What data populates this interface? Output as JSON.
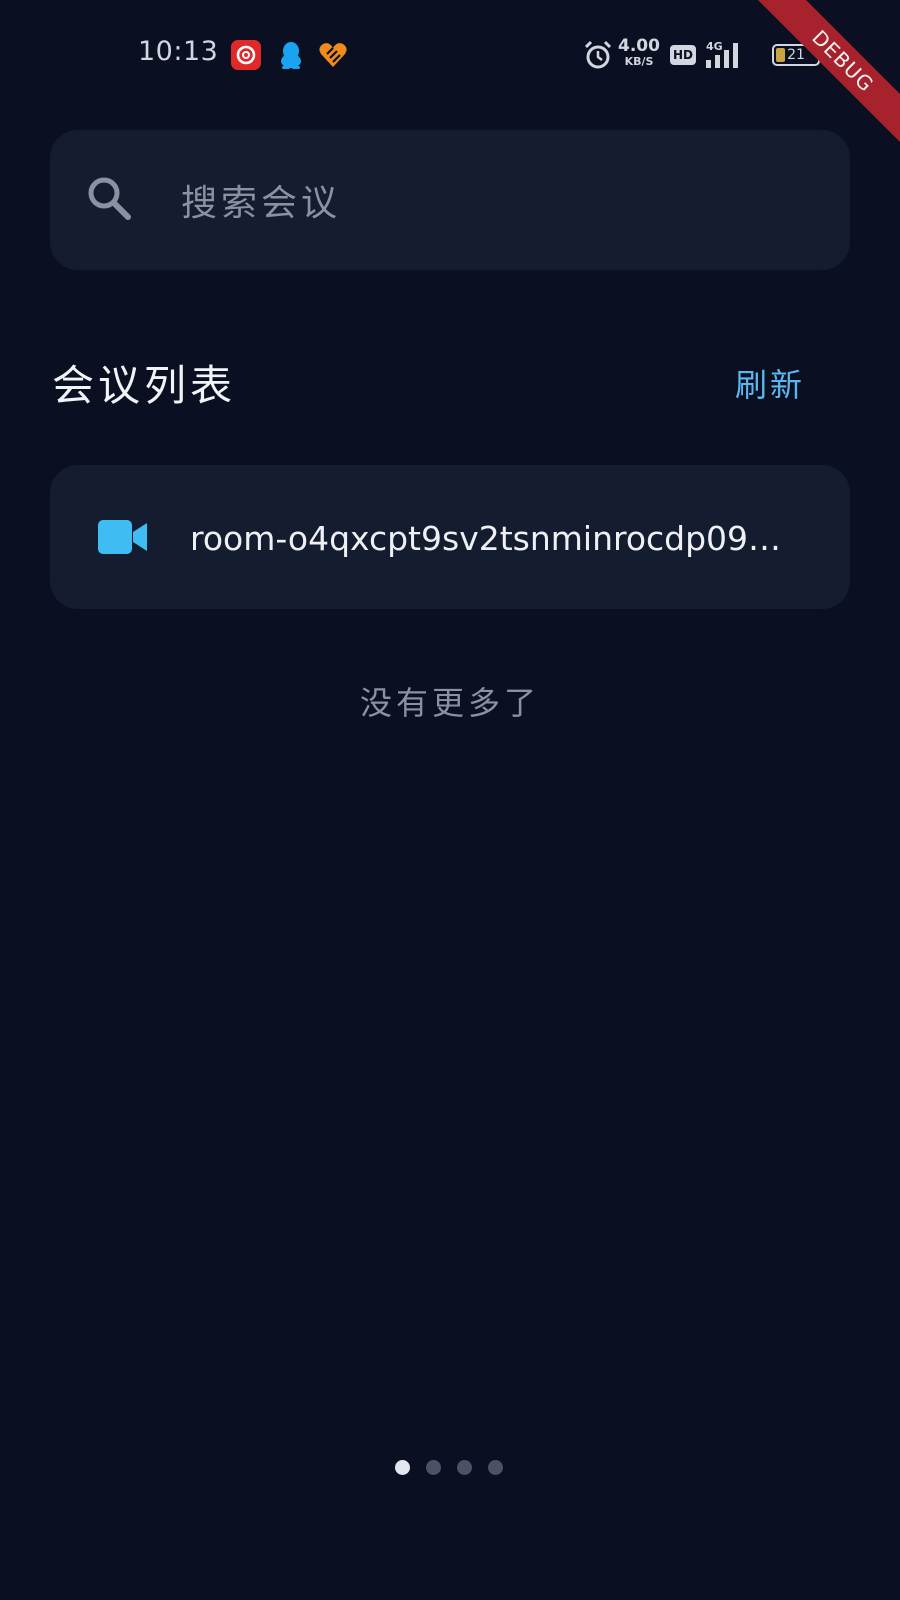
{
  "status_bar": {
    "time": "10:13",
    "net_speed_value": "4.00",
    "net_speed_unit": "KB/S",
    "hd_label": "HD",
    "network_label": "4G",
    "battery_level": "21",
    "icons": [
      "netease-music-icon",
      "qq-icon",
      "heart-app-icon",
      "alarm-icon",
      "hd-icon",
      "signal-icon",
      "battery-icon"
    ]
  },
  "debug_banner": "DEBUG",
  "search": {
    "placeholder": "搜索会议"
  },
  "meetings": {
    "title": "会议列表",
    "refresh_label": "刷新",
    "items": [
      {
        "name": "room-o4qxcpt9sv2tsnminrocdp09…",
        "icon": "video-camera-icon"
      }
    ],
    "end_text": "没有更多了"
  },
  "pager": {
    "count": 4,
    "active_index": 0
  },
  "colors": {
    "background": "#0a1021",
    "card": "#141c30",
    "accent": "#5cb7ef",
    "debug": "#a8222d"
  }
}
